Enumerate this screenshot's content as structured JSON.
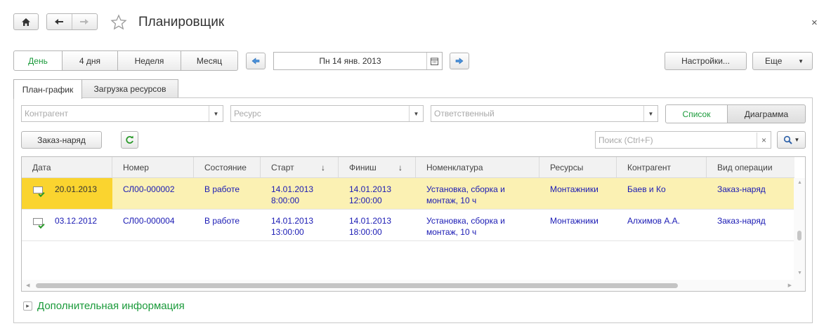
{
  "window": {
    "title": "Планировщик"
  },
  "nav": {
    "home_icon": "home-icon",
    "back_icon": "arrow-left-icon",
    "forward_icon": "arrow-right-icon",
    "favorite_icon": "star-icon",
    "close_icon": "close-icon"
  },
  "period": {
    "options": [
      "День",
      "4 дня",
      "Неделя",
      "Месяц"
    ],
    "active": "День"
  },
  "date": {
    "value": "Пн 14 янв. 2013"
  },
  "toolbar": {
    "settings_label": "Настройки...",
    "more_label": "Еще"
  },
  "tabs": [
    "План-график",
    "Загрузка ресурсов"
  ],
  "filters": {
    "contractor_placeholder": "Контрагент",
    "resource_placeholder": "Ресурс",
    "responsible_placeholder": "Ответственный"
  },
  "view_toggle": {
    "list_label": "Список",
    "diagram_label": "Диаграмма"
  },
  "actions": {
    "work_order_label": "Заказ-наряд",
    "search_placeholder": "Поиск (Ctrl+F)",
    "search_clear": "×"
  },
  "table": {
    "columns": [
      "Дата",
      "Номер",
      "Состояние",
      "Старт",
      "Финиш",
      "Номенклатура",
      "Ресурсы",
      "Контрагент",
      "Вид операции"
    ],
    "sort_arrow": "↓",
    "rows": [
      {
        "date": "20.01.2013",
        "number": "СЛ00-000002",
        "state": "В работе",
        "start_date": "14.01.2013",
        "start_time": "8:00:00",
        "finish_date": "14.01.2013",
        "finish_time": "12:00:00",
        "nomenclature_1": "Установка, сборка и",
        "nomenclature_2": "монтаж, 10 ч",
        "resources": "Монтажники",
        "contractor": "Баев и Ко",
        "operation": "Заказ-наряд"
      },
      {
        "date": "03.12.2012",
        "number": "СЛ00-000004",
        "state": "В работе",
        "start_date": "14.01.2013",
        "start_time": "13:00:00",
        "finish_date": "14.01.2013",
        "finish_time": "18:00:00",
        "nomenclature_1": "Установка, сборка и",
        "nomenclature_2": "монтаж, 10 ч",
        "resources": "Монтажники",
        "contractor": "Алхимов А.А.",
        "operation": "Заказ-наряд"
      }
    ]
  },
  "footer": {
    "more_info_label": "Дополнительная информация"
  },
  "colors": {
    "accent_green": "#1a9a3a",
    "link_blue": "#1a1ab4",
    "selected_row": "#fbf1b3",
    "selected_cell": "#fad42f"
  }
}
